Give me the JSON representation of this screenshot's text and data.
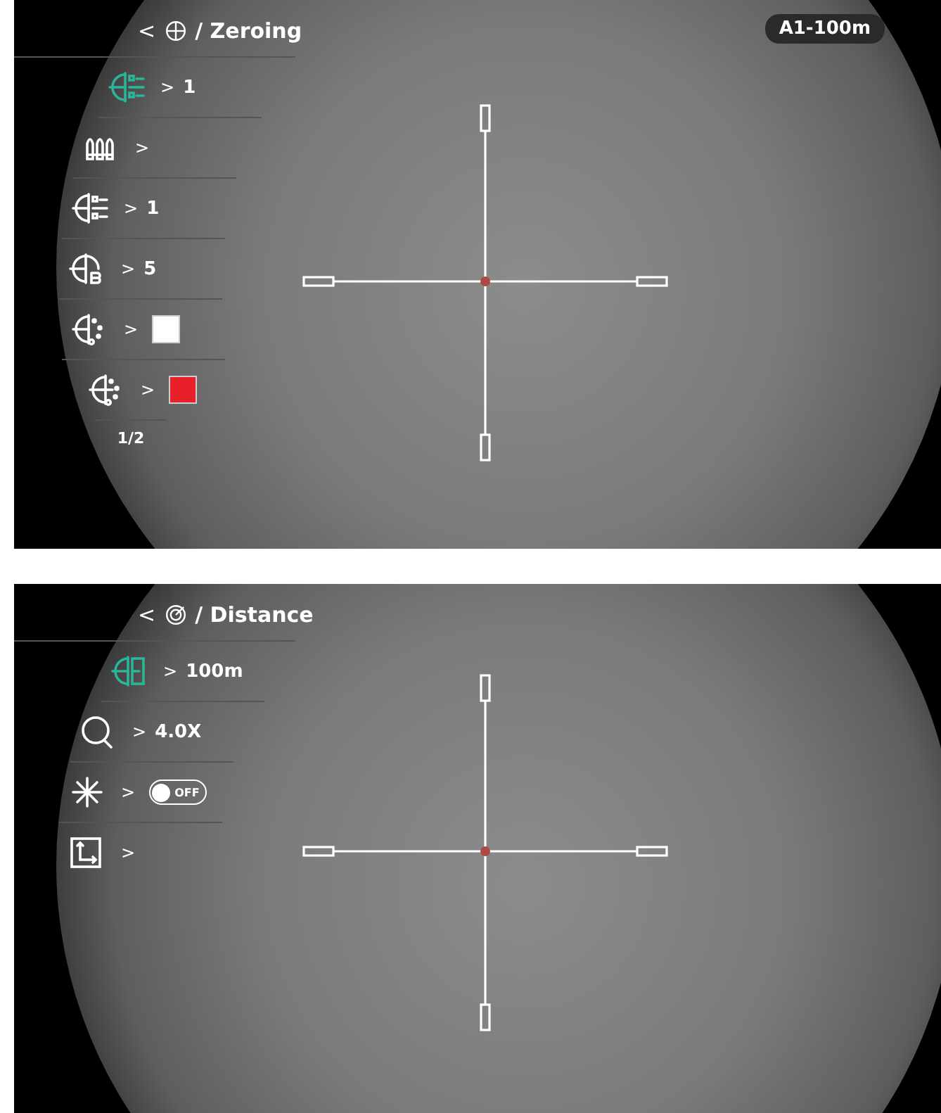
{
  "screens": [
    {
      "back": "<",
      "title": "/ Zeroing",
      "badge": "A1-100m",
      "page": "1/2",
      "items": [
        {
          "kind": "value",
          "selected": true,
          "arrow": ">",
          "value": "1"
        },
        {
          "kind": "none",
          "selected": false,
          "arrow": ">"
        },
        {
          "kind": "value",
          "selected": false,
          "arrow": ">",
          "value": "1"
        },
        {
          "kind": "value",
          "selected": false,
          "arrow": ">",
          "value": "5"
        },
        {
          "kind": "swatch",
          "selected": false,
          "arrow": ">",
          "color": "#ffffff"
        },
        {
          "kind": "swatch",
          "selected": false,
          "arrow": ">",
          "color": "#e8202a"
        }
      ]
    },
    {
      "back": "<",
      "title": "/ Distance",
      "items": [
        {
          "kind": "value",
          "selected": true,
          "arrow": ">",
          "value": "100m"
        },
        {
          "kind": "value",
          "selected": false,
          "arrow": ">",
          "value": "4.0X"
        },
        {
          "kind": "toggle",
          "selected": false,
          "arrow": ">",
          "on": false,
          "label": "OFF"
        },
        {
          "kind": "none",
          "selected": false,
          "arrow": ">"
        }
      ]
    }
  ]
}
